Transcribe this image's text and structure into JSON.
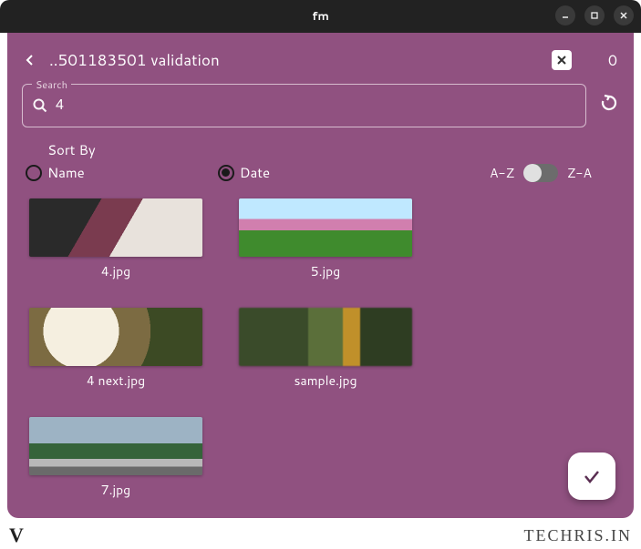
{
  "titlebar": {
    "title": "fm"
  },
  "nav": {
    "breadcrumb": "..501183501 validation",
    "count": "0"
  },
  "search": {
    "legend": "Search",
    "value": "4"
  },
  "sort": {
    "label": "Sort By",
    "options": [
      "Name",
      "Date"
    ],
    "selected": "Date",
    "order_az": "A-Z",
    "order_za": "Z-A"
  },
  "files": [
    {
      "name": "4.jpg"
    },
    {
      "name": "5.jpg"
    },
    {
      "name": "4 next.jpg"
    },
    {
      "name": "sample.jpg"
    },
    {
      "name": "7.jpg"
    }
  ],
  "footer": {
    "left_mark": "V",
    "brand": "TECHRIS.IN"
  }
}
